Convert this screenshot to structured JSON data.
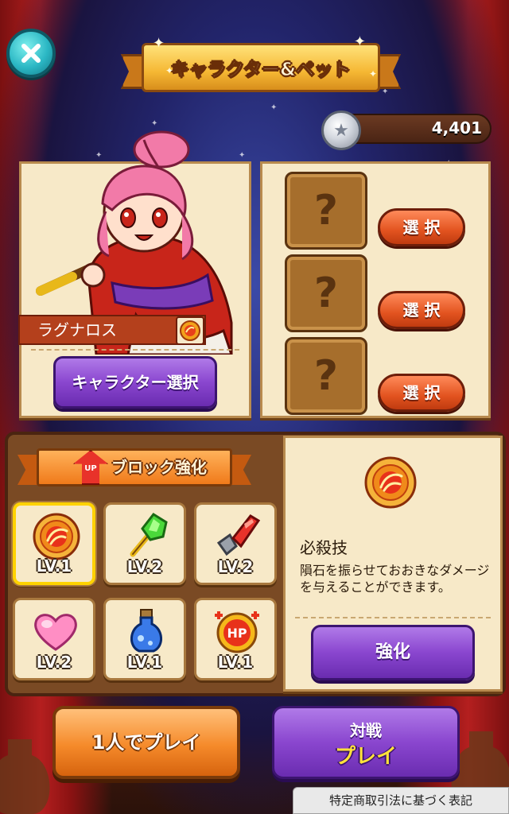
{
  "header": {
    "title": "キャラクター&ペット",
    "coins": "4,401"
  },
  "character": {
    "name": "ラグナロス",
    "select_button": "キャラクター選択"
  },
  "pets": {
    "slots": [
      {
        "placeholder": "?",
        "button": "選 択"
      },
      {
        "placeholder": "?",
        "button": "選 択"
      },
      {
        "placeholder": "?",
        "button": "選 択"
      }
    ]
  },
  "block_upgrade": {
    "badge": "UP",
    "title": "ブロック強化",
    "items": [
      {
        "icon": "meteor-orb-icon",
        "level": "LV.1",
        "selected": true
      },
      {
        "icon": "green-gem-staff-icon",
        "level": "LV.2",
        "selected": false
      },
      {
        "icon": "red-crystal-sword-icon",
        "level": "LV.2",
        "selected": false
      },
      {
        "icon": "heart-icon",
        "level": "LV.2",
        "selected": false
      },
      {
        "icon": "blue-potion-icon",
        "level": "LV.1",
        "selected": false
      },
      {
        "icon": "hp-orb-icon",
        "level": "LV.1",
        "selected": false
      }
    ]
  },
  "detail": {
    "title": "必殺技",
    "description": "隕石を振らせておおきなダメージを与えることができます。",
    "upgrade_button": "強化"
  },
  "footer": {
    "solo_button": "1人でプレイ",
    "versus_line1": "対戦",
    "versus_line2": "プレイ",
    "legal_link": "特定商取引法に基づく表記"
  },
  "colors": {
    "accent_purple": "#8a46cf",
    "accent_orange": "#f58a2a",
    "accent_red": "#e2531f",
    "parchment": "#f7e9c8",
    "close_teal": "#2bb7c4"
  }
}
